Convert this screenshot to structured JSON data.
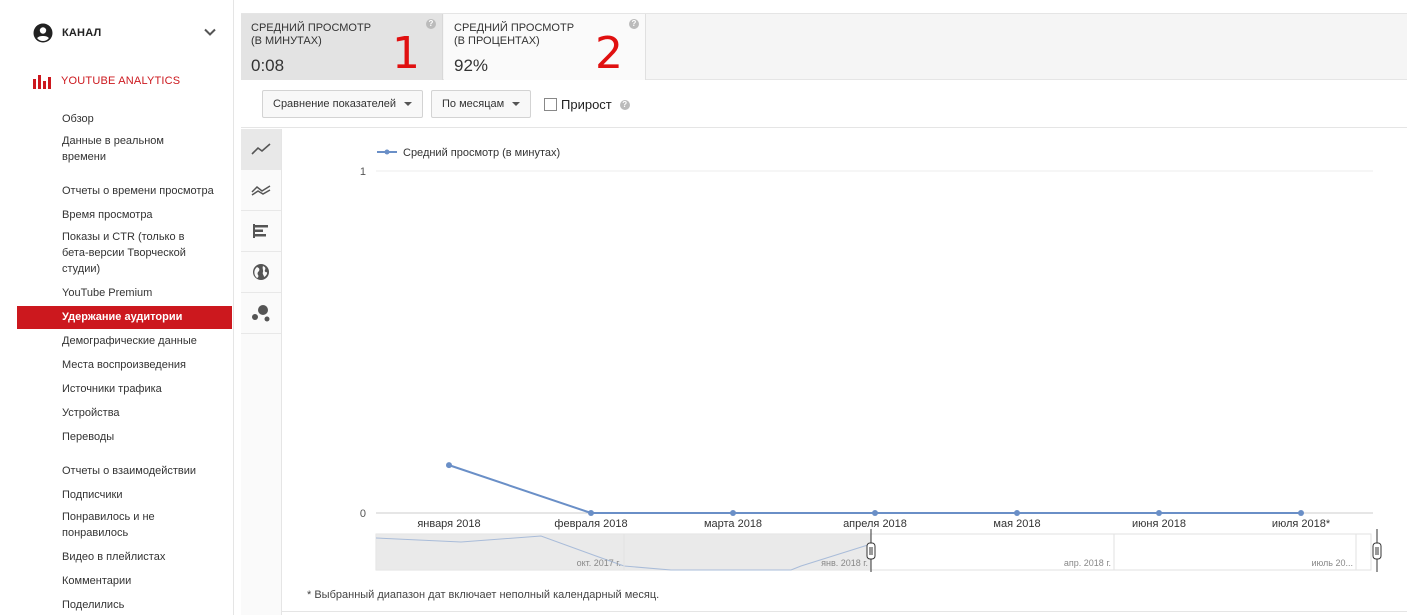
{
  "sidebar": {
    "channel_label": "КАНАЛ",
    "analytics_label": "YOUTUBE ANALYTICS",
    "items_top": [
      {
        "label": "Обзор"
      },
      {
        "label": "Данные в реальном времени"
      }
    ],
    "section_watch": "Отчеты о времени просмотра",
    "items_watch": [
      {
        "label": "Время просмотра"
      },
      {
        "label": "Показы и CTR (только в бета-версии Творческой студии)"
      },
      {
        "label": "YouTube Premium"
      }
    ],
    "active_item": "Удержание аудитории",
    "items_watch2": [
      {
        "label": "Демографические данные"
      },
      {
        "label": "Места воспроизведения"
      },
      {
        "label": "Источники трафика"
      },
      {
        "label": "Устройства"
      },
      {
        "label": "Переводы"
      }
    ],
    "section_engage": "Отчеты о взаимодействии",
    "items_engage": [
      {
        "label": "Подписчики"
      },
      {
        "label": "Понравилось и не понравилось"
      },
      {
        "label": "Видео в плейлистах"
      },
      {
        "label": "Комментарии"
      },
      {
        "label": "Поделились"
      }
    ]
  },
  "metrics": {
    "m1_title_line1": "СРЕДНИЙ ПРОСМОТР",
    "m1_title_line2": "(В МИНУТАХ)",
    "m1_value": "0:08",
    "m1_annotation": "1",
    "m2_title_line1": "СРЕДНИЙ ПРОСМОТР",
    "m2_title_line2": "(В ПРОЦЕНТАХ)",
    "m2_value": "92%",
    "m2_annotation": "2",
    "help_glyph": "?"
  },
  "toolbar": {
    "compare_label": "Сравнение показателей",
    "period_label": "По месяцам",
    "growth_label": "Прирост"
  },
  "chart_data": {
    "type": "line",
    "series": [
      {
        "name": "Средний просмотр (в минутах)",
        "values": [
          0.14,
          0,
          0,
          0,
          0,
          0,
          0
        ]
      }
    ],
    "categories": [
      "января 2018",
      "февраля 2018",
      "марта 2018",
      "апреля 2018",
      "мая 2018",
      "июня 2018",
      "июля 2018*"
    ],
    "ylim": [
      0,
      1
    ],
    "yticks": [
      "0",
      "1"
    ],
    "legend_position": "top-left",
    "line_color": "#6a8fc7",
    "navigator_labels": [
      "окт. 2017 г.",
      "янв. 2018 г.",
      "апр. 2018 г.",
      "июль 20..."
    ]
  },
  "footnote": "* Выбранный диапазон дат включает неполный календарный месяц."
}
